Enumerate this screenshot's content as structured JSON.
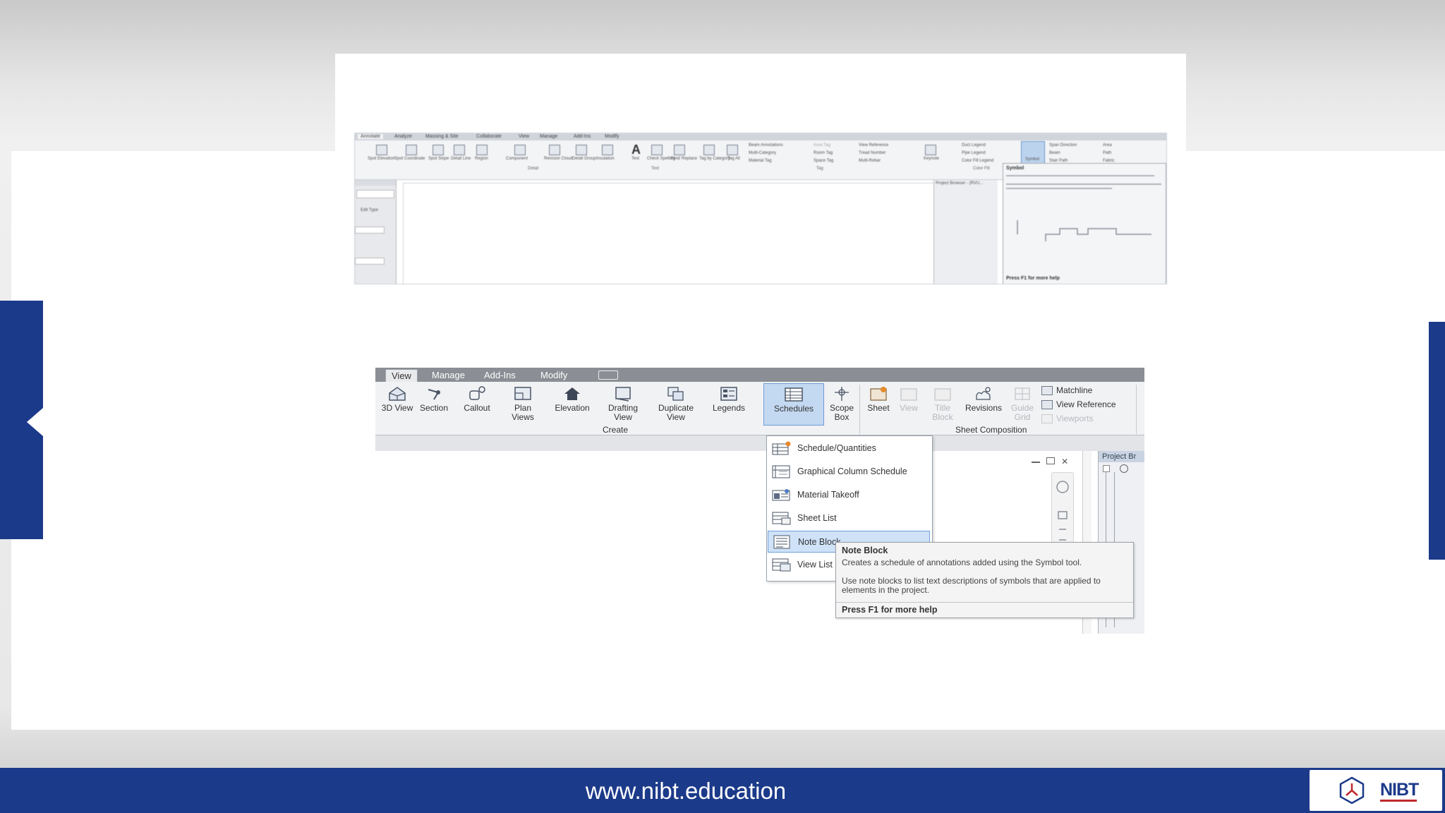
{
  "footer": {
    "url": "www.nibt.education",
    "logo_text": "NIBT"
  },
  "colors": {
    "brand_blue": "#1c3a8a",
    "selected_blue": "#c3d8f1",
    "logo_red": "#c0282d"
  },
  "ribbon_small": {
    "tabs": [
      "Annotate",
      "Analyze",
      "Massing & Site",
      "Collaborate",
      "View",
      "Manage",
      "Add-Ins",
      "Modify"
    ],
    "tools": [
      "Spot Elevation",
      "Spot Coordinate",
      "Spot Slope",
      "Detail Line",
      "Region",
      "Component",
      "Revision Cloud",
      "Detail Group",
      "Insulation",
      "Text",
      "Check Spelling",
      "Find/ Replace",
      "Tag by Category",
      "Tag All",
      "Keynote",
      "Symbol"
    ],
    "panels": [
      "Detail",
      "Text",
      "Tag",
      "Color Fill"
    ],
    "tag_rows": [
      "Beam Annotations",
      "Multi-Category",
      "Material Tag"
    ],
    "tag_rows2": [
      "Area Tag",
      "Room Tag",
      "Space Tag"
    ],
    "tag_rows3": [
      "View Reference",
      "Tread Number",
      "Multi-Rebar"
    ],
    "legend_rows": [
      "Duct Legend",
      "Pipe Legend",
      "Color Fill Legend"
    ],
    "symbol_rows": [
      "Span Direction",
      "Beam",
      "Stair Path"
    ],
    "symbol_rows2": [
      "Area",
      "Path",
      "Fabric"
    ],
    "tooltip_title": "Symbol",
    "tooltip_foot": "Press F1 for more help",
    "props": "Edit Type",
    "browser_title": "Project Browser - (RVU..."
  },
  "ribbon_large": {
    "tabs": [
      "View",
      "Manage",
      "Add-Ins",
      "Modify"
    ],
    "buttons": [
      {
        "label": "3D View"
      },
      {
        "label": "Section"
      },
      {
        "label": "Callout"
      },
      {
        "label": "Plan Views"
      },
      {
        "label": "Elevation"
      },
      {
        "label": "Drafting View"
      },
      {
        "label": "Duplicate View"
      },
      {
        "label": "Legends"
      },
      {
        "label": "Schedules"
      },
      {
        "label": "Scope Box"
      },
      {
        "label": "Sheet"
      },
      {
        "label": "View"
      },
      {
        "label": "Title Block"
      },
      {
        "label": "Revisions"
      },
      {
        "label": "Guide Grid"
      }
    ],
    "side_rows": [
      "Matchline",
      "View Reference",
      "Viewports"
    ],
    "panels": {
      "create": "Create",
      "sheet_composition": "Sheet Composition"
    },
    "project_browser": "Project Br",
    "dropdown": [
      "Schedule/Quantities",
      "Graphical Column Schedule",
      "Material Takeoff",
      "Sheet List",
      "Note Block",
      "View List"
    ],
    "tooltip": {
      "title": "Note Block",
      "description": "Creates a schedule of annotations added using the Symbol tool.",
      "body": "Use note blocks to list text descriptions of symbols that are applied to elements in the project.",
      "footer": "Press F1 for more help"
    }
  }
}
